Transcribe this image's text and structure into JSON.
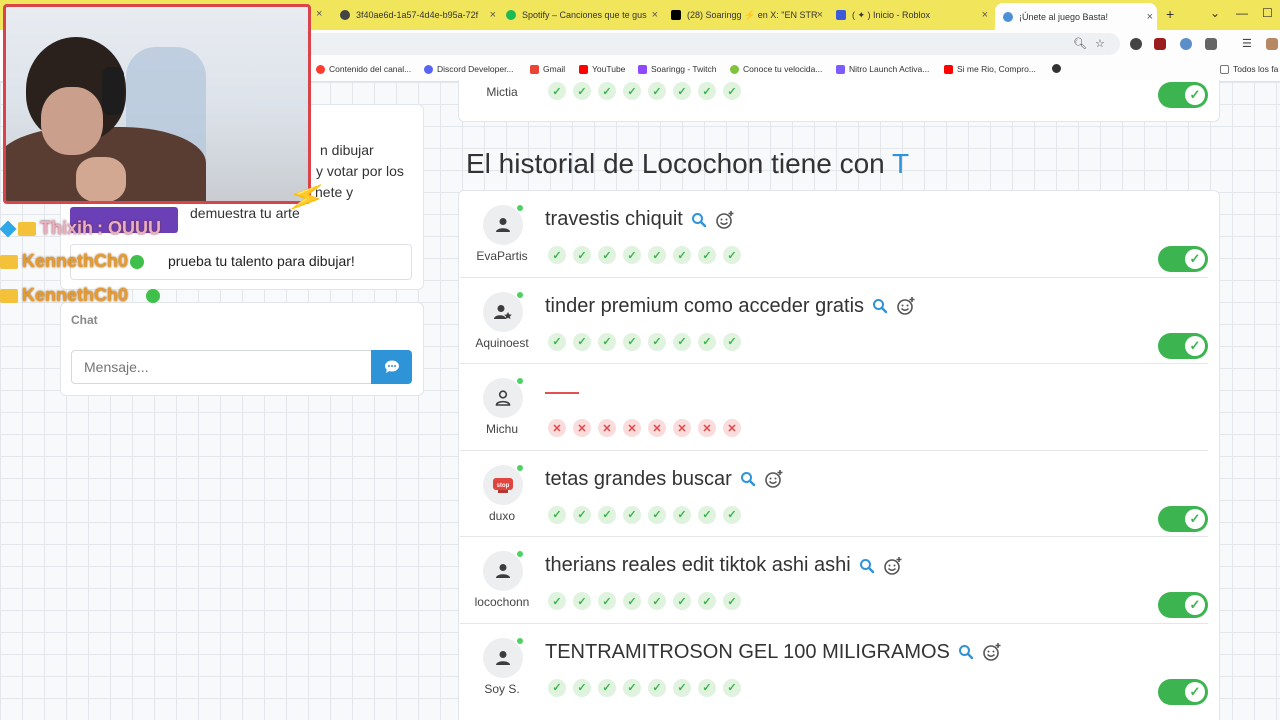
{
  "browser": {
    "tabs": [
      {
        "label": "3f40ae6d-1a57-4d4e-b95a-72f",
        "color": "#444444"
      },
      {
        "label": "Spotify – Canciones que te gus",
        "color": "#1db954"
      },
      {
        "label": "(28) Soaringg ⚡ en X: \"EN STR",
        "color": "#000000"
      },
      {
        "label": "( ✦ ) Inicio - Roblox",
        "color": "#3b5bdb"
      },
      {
        "label": "¡Únete al juego Basta!",
        "color": "#4a90d9"
      }
    ],
    "bookmarks": [
      {
        "label": "Contenido del canal...",
        "color": "#ff3b30"
      },
      {
        "label": "Discord Developer...",
        "color": "#5865f2"
      },
      {
        "label": "Gmail",
        "color": "#ea4335"
      },
      {
        "label": "YouTube",
        "color": "#ff0000"
      },
      {
        "label": "Soaringg - Twitch",
        "color": "#9146ff"
      },
      {
        "label": "Conoce tu velocida...",
        "color": "#7ec33b"
      },
      {
        "label": "Nitro Launch Activa...",
        "color": "#7c5cff"
      },
      {
        "label": "Si me Rio, Compro...",
        "color": "#ff0000"
      },
      {
        "label": "Todos los fa",
        "color": "#777777"
      }
    ]
  },
  "info": {
    "line1": "n dibujar",
    "line2": "y votar por los",
    "line3": "nete y",
    "line4": "demuestra tu arte",
    "prompt": "prueba tu talento para dibujar!"
  },
  "chat": {
    "label": "Chat",
    "placeholder": "Mensaje..."
  },
  "stream_chat": [
    {
      "user": "Thixih",
      "message": ": OUUU"
    },
    {
      "user": "KennethCh0",
      "message": ": "
    },
    {
      "user": "KennethCh0",
      "message": ": "
    }
  ],
  "top_row": {
    "user": "Mictia"
  },
  "history": {
    "title_prefix": "El historial de Locochon tiene con",
    "letter": "T"
  },
  "rows": [
    {
      "user": "EvaPartis",
      "answer": "travestis chiquit",
      "valid": true,
      "avatar": "person"
    },
    {
      "user": "Aquinoest",
      "answer": "tinder premium como acceder gratis",
      "valid": true,
      "avatar": "person-star"
    },
    {
      "user": "Michu",
      "answer": "",
      "valid": false,
      "avatar": "person-outline"
    },
    {
      "user": "duxo",
      "answer": "tetas grandes buscar",
      "valid": true,
      "avatar": "stop"
    },
    {
      "user": "locochonn",
      "answer": "therians reales edit tiktok ashi ashi",
      "valid": true,
      "avatar": "person"
    },
    {
      "user": "Soy S.",
      "answer": "TENTRAMITROSON GEL 100 MILIGRAMOS",
      "valid": true,
      "avatar": "person"
    }
  ],
  "stop_label": "stop",
  "colors": {
    "accent": "#2f93d8",
    "valid_toggle": "#3cb450",
    "online": "#4cd263",
    "reject": "#e04848"
  }
}
